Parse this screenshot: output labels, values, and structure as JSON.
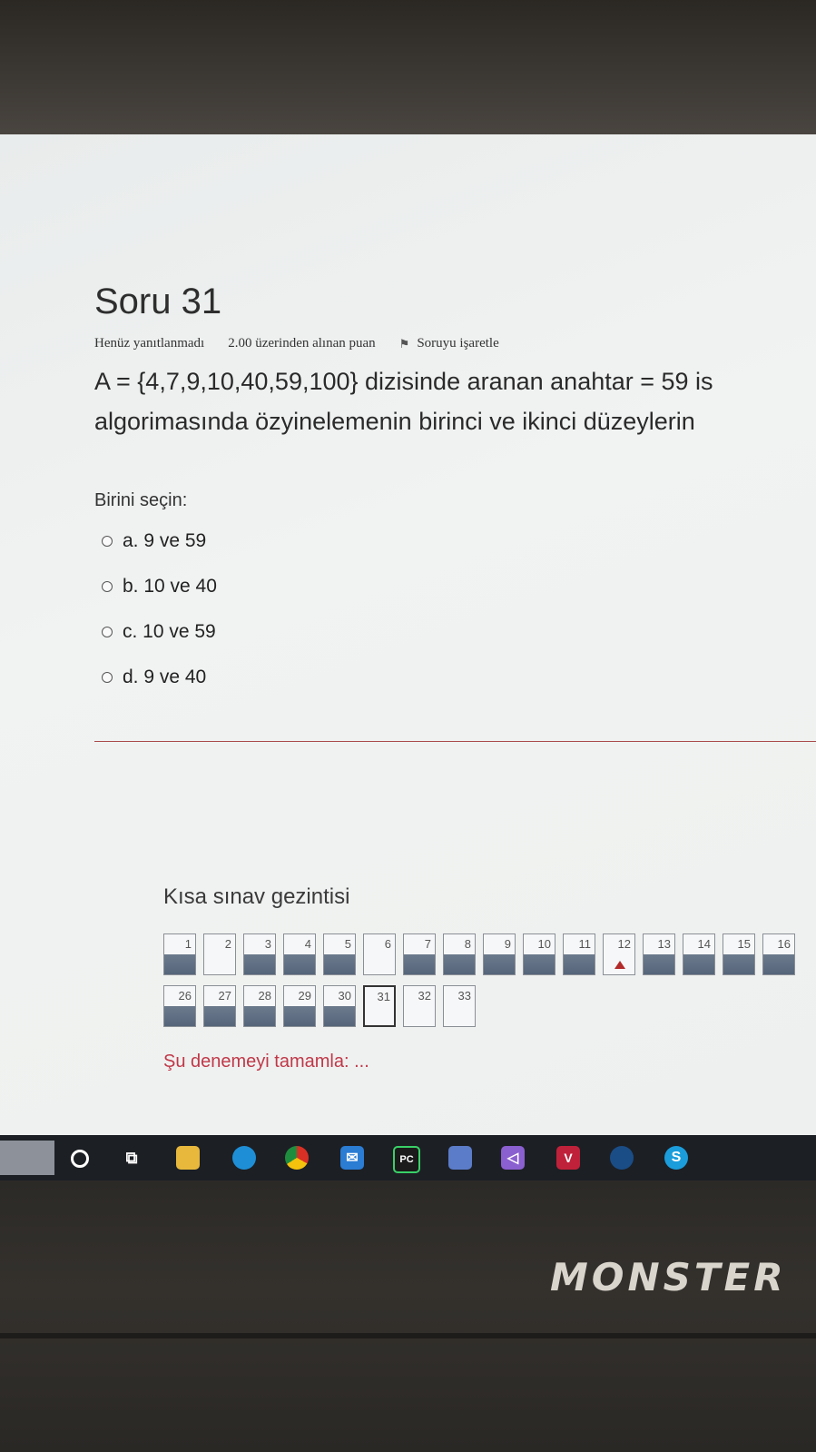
{
  "question": {
    "title": "Soru 31",
    "status": "Henüz yanıtlanmadı",
    "points": "2.00 üzerinden alınan puan",
    "flag_label": "Soruyu işaretle",
    "text_line1": "A = {4,7,9,10,40,59,100} dizisinde aranan anahtar = 59 is",
    "text_line2": "algorimasında özyinelemenin birinci ve ikinci düzeylerin",
    "prompt": "Birini seçin:",
    "options": [
      {
        "label": "a. 9 ve 59"
      },
      {
        "label": "b. 10 ve 40"
      },
      {
        "label": "c. 10 ve 59"
      },
      {
        "label": "d. 9 ve 40"
      }
    ]
  },
  "navigation": {
    "title": "Kısa sınav gezintisi",
    "row1": [
      "1",
      "2",
      "3",
      "4",
      "5",
      "6",
      "7",
      "8",
      "9",
      "10",
      "11",
      "12",
      "13",
      "14",
      "15",
      "16"
    ],
    "row2": [
      "26",
      "27",
      "28",
      "29",
      "30",
      "31",
      "32",
      "33"
    ],
    "answered": [
      "1",
      "3",
      "4",
      "5",
      "7",
      "8",
      "9",
      "10",
      "11",
      "13",
      "14",
      "15",
      "16",
      "26",
      "27",
      "28",
      "29",
      "30"
    ],
    "flagged": [
      "12"
    ],
    "current": "31",
    "finish_label": "Şu denemeyi tamamla: ..."
  },
  "taskbar": {
    "icons": [
      "search-icon",
      "task-view-icon",
      "file-explorer-icon",
      "edge-icon",
      "chrome-icon",
      "mail-icon",
      "pycharm-icon",
      "virtualbox-icon",
      "visual-studio-icon",
      "vivaldi-icon",
      "steam-icon",
      "skype-icon"
    ]
  },
  "laptop": {
    "brand": "MONSTER"
  },
  "colors": {
    "answered_fill": "#5f6e82",
    "flag": "#b22a2a",
    "link": "#c03848",
    "divider": "#a94a4a"
  }
}
